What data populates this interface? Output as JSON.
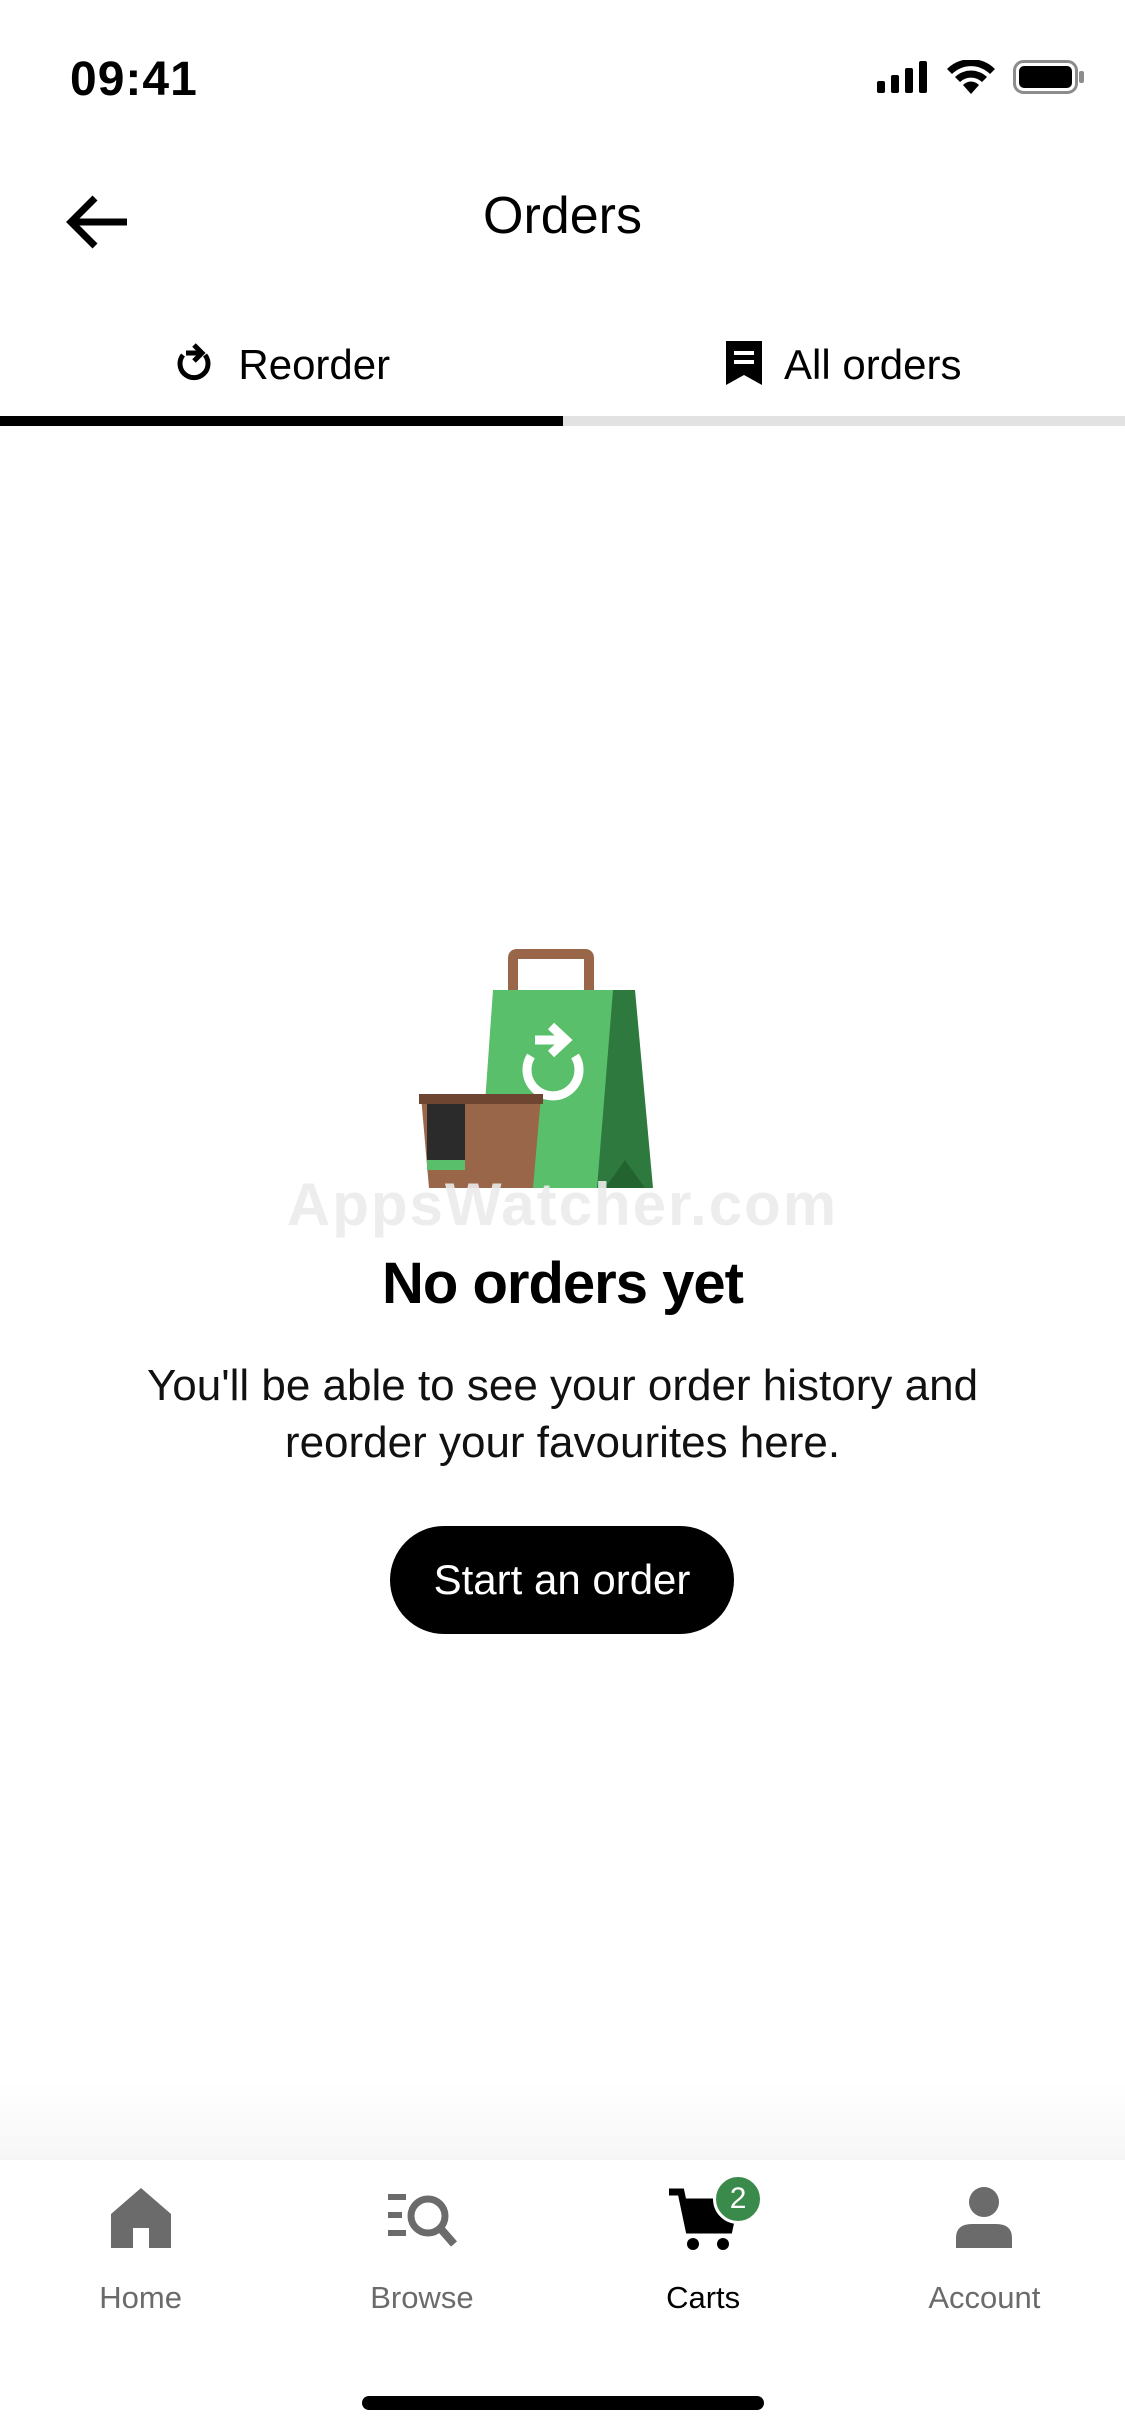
{
  "status_bar": {
    "time": "09:41",
    "icons": [
      "signal-icon",
      "wifi-icon",
      "battery-icon"
    ]
  },
  "header": {
    "title": "Orders",
    "back_icon": "arrow-left-icon"
  },
  "tabs": [
    {
      "label": "Reorder",
      "icon": "reorder-icon",
      "active": true
    },
    {
      "label": "All orders",
      "icon": "receipt-icon",
      "active": false
    }
  ],
  "watermark": "AppsWatcher.com",
  "empty_state": {
    "illustration": "shopping-bag-reorder-illustration",
    "title": "No orders yet",
    "description": "You'll be able to see your order history and reorder your favourites here.",
    "button_label": "Start an order"
  },
  "bottom_nav": {
    "items": [
      {
        "label": "Home",
        "icon": "home-icon",
        "active": false
      },
      {
        "label": "Browse",
        "icon": "browse-search-icon",
        "active": false
      },
      {
        "label": "Carts",
        "icon": "cart-icon",
        "active": true,
        "badge": "2"
      },
      {
        "label": "Account",
        "icon": "person-icon",
        "active": false
      }
    ]
  },
  "colors": {
    "accent_green": "#3a8a4b",
    "bag_green": "#5abf6a",
    "bag_dark_green": "#2e7a3e",
    "cup_brown": "#9a6649",
    "tab_active": "#000000",
    "tab_inactive": "#e2e2e2",
    "nav_inactive": "#6b6b6b"
  }
}
